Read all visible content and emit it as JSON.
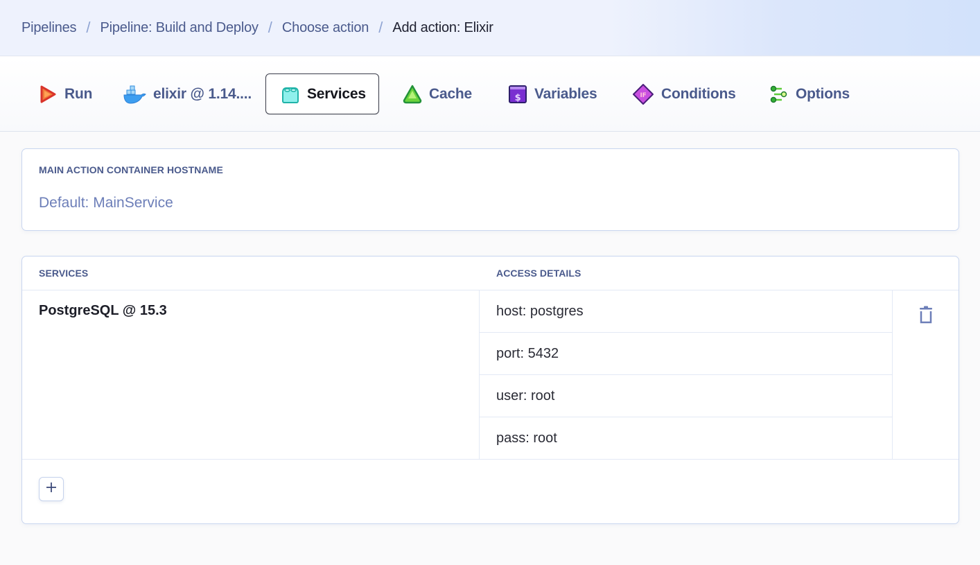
{
  "breadcrumb": {
    "items": [
      {
        "label": "Pipelines"
      },
      {
        "label": "Pipeline: Build and Deploy"
      },
      {
        "label": "Choose action"
      },
      {
        "label": "Add action: Elixir"
      }
    ],
    "separator": "/"
  },
  "tabs": [
    {
      "label": "Run",
      "icon": "play-icon"
    },
    {
      "label": "elixir @ 1.14....",
      "icon": "docker-icon"
    },
    {
      "label": "Services",
      "icon": "service-block-icon",
      "active": true
    },
    {
      "label": "Cache",
      "icon": "cache-triangle-icon"
    },
    {
      "label": "Variables",
      "icon": "variables-dollar-icon"
    },
    {
      "label": "Conditions",
      "icon": "conditions-if-icon"
    },
    {
      "label": "Options",
      "icon": "options-sliders-icon"
    }
  ],
  "hostname": {
    "label": "MAIN ACTION CONTAINER HOSTNAME",
    "value": "",
    "placeholder": "Default: MainService"
  },
  "services_table": {
    "headers": {
      "services": "SERVICES",
      "access": "ACCESS DETAILS"
    },
    "rows": [
      {
        "name": "PostgreSQL @ 15.3",
        "access": [
          "host: postgres",
          "port: 5432",
          "user: root",
          "pass: root"
        ]
      }
    ],
    "add_label": "+"
  },
  "colors": {
    "accent_text": "#4a5a8c",
    "border": "#c9d6ef",
    "icon_muted": "#6c7eb8"
  }
}
